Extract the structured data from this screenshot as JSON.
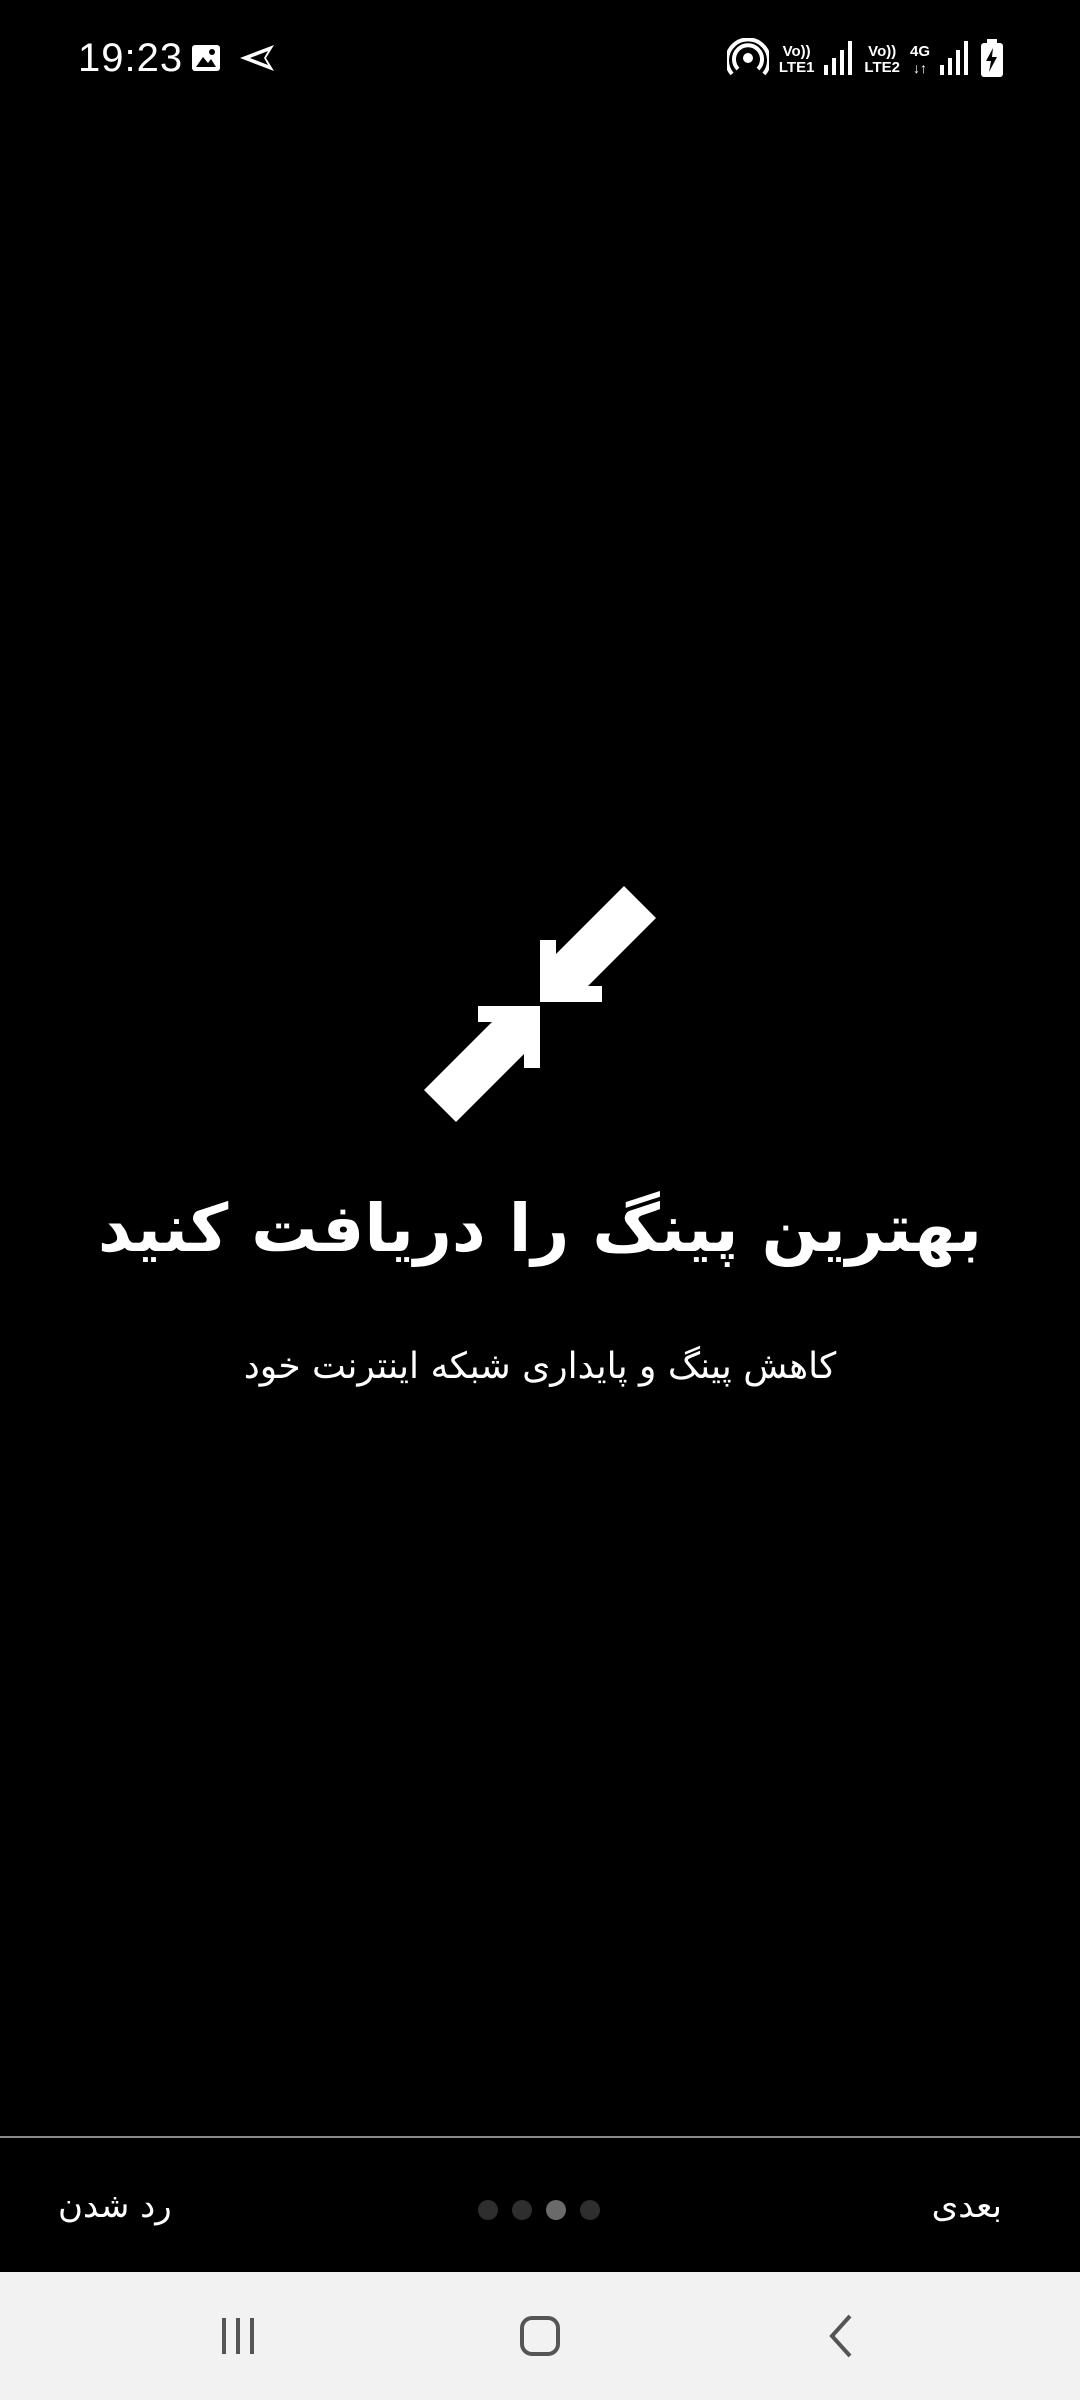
{
  "status_bar": {
    "time": "19:23",
    "left_icons": [
      "image-icon",
      "send-icon"
    ],
    "right_icons": [
      "hotspot-icon",
      "volte-lte1-icon",
      "signal-icon",
      "volte-lte2-icon",
      "network-4g-icon",
      "signal-icon",
      "battery-charging-icon"
    ],
    "sim1_top": "Vo))",
    "sim1_bottom": "LTE1",
    "sim2_top": "Vo))",
    "sim2_bottom": "LTE2",
    "network_type": "4G"
  },
  "hero": {
    "icon": "compress-arrows-icon",
    "headline": "بهترین پینگ را دریافت کنید",
    "subline": "کاهش پینگ و پایداری شبکه اینترنت خود"
  },
  "footer": {
    "skip_label": "رد شدن",
    "next_label": "بعدی",
    "page_count": 4,
    "active_page": 3
  },
  "nav_bar": {
    "buttons": [
      "recent-apps-icon",
      "home-icon",
      "back-icon"
    ]
  },
  "colors": {
    "background": "#000000",
    "text": "#ffffff",
    "nav_bar_bg": "#f2f2f2",
    "dot_inactive": "#2e2e2e",
    "dot_active": "#6a6a6a",
    "divider": "#8a8a8a"
  }
}
